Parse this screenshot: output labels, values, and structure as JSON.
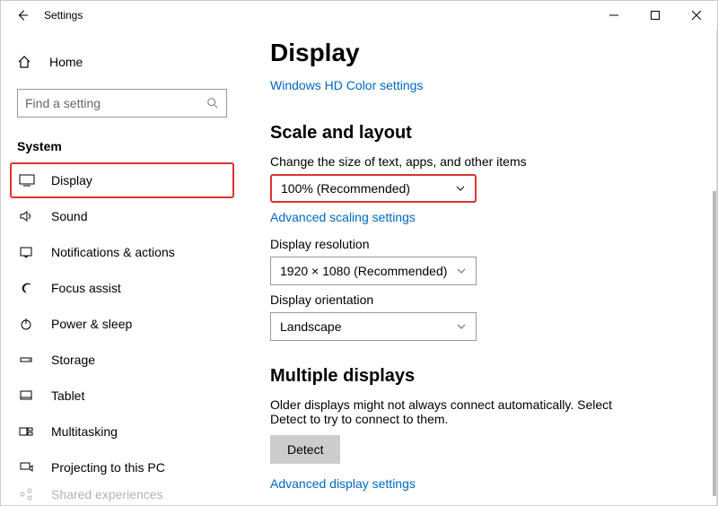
{
  "window": {
    "title": "Settings"
  },
  "sidebar": {
    "home": "Home",
    "search_placeholder": "Find a setting",
    "category": "System",
    "items": [
      {
        "label": "Display"
      },
      {
        "label": "Sound"
      },
      {
        "label": "Notifications & actions"
      },
      {
        "label": "Focus assist"
      },
      {
        "label": "Power & sleep"
      },
      {
        "label": "Storage"
      },
      {
        "label": "Tablet"
      },
      {
        "label": "Multitasking"
      },
      {
        "label": "Projecting to this PC"
      },
      {
        "label": "Shared experiences"
      }
    ]
  },
  "main": {
    "title": "Display",
    "link1": "Windows HD Color settings",
    "section1": "Scale and layout",
    "scale_label": "Change the size of text, apps, and other items",
    "scale_value": "100% (Recommended)",
    "link2": "Advanced scaling settings",
    "res_label": "Display resolution",
    "res_value": "1920 × 1080 (Recommended)",
    "orient_label": "Display orientation",
    "orient_value": "Landscape",
    "section2": "Multiple displays",
    "multi_desc": "Older displays might not always connect automatically. Select Detect to try to connect to them.",
    "detect": "Detect",
    "link3": "Advanced display settings"
  }
}
